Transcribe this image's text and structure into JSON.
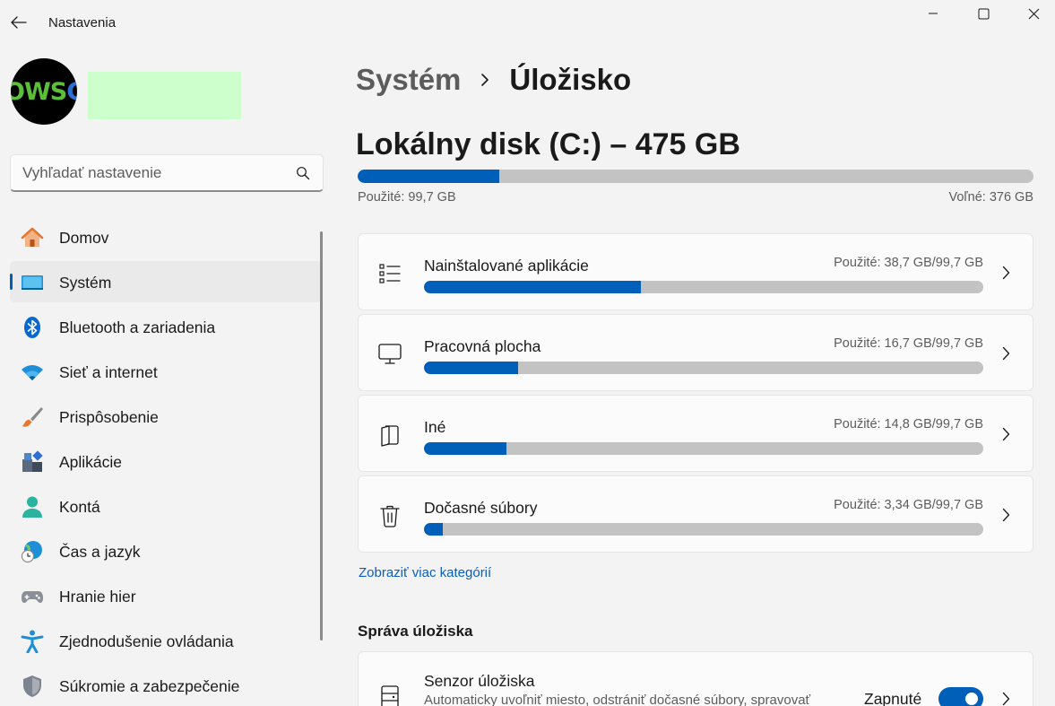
{
  "window": {
    "title": "Nastavenia"
  },
  "profile": {
    "avatar_text": "OWSC"
  },
  "search": {
    "placeholder": "Vyhľadať nastavenie"
  },
  "sidebar": {
    "items": [
      {
        "label": "Domov",
        "icon": "home-icon",
        "active": false
      },
      {
        "label": "Systém",
        "icon": "system-monitor-icon",
        "active": true
      },
      {
        "label": "Bluetooth a zariadenia",
        "icon": "bluetooth-icon",
        "active": false
      },
      {
        "label": "Sieť a internet",
        "icon": "wifi-icon",
        "active": false
      },
      {
        "label": "Prispôsobenie",
        "icon": "paintbrush-icon",
        "active": false
      },
      {
        "label": "Aplikácie",
        "icon": "apps-icon",
        "active": false
      },
      {
        "label": "Kontá",
        "icon": "user-icon",
        "active": false
      },
      {
        "label": "Čas a jazyk",
        "icon": "globe-clock-icon",
        "active": false
      },
      {
        "label": "Hranie hier",
        "icon": "gamepad-icon",
        "active": false
      },
      {
        "label": "Zjednodušenie ovládania",
        "icon": "accessibility-icon",
        "active": false
      },
      {
        "label": "Súkromie a zabezpečenie",
        "icon": "shield-icon",
        "active": false
      }
    ]
  },
  "breadcrumb": {
    "parent": "Systém",
    "current": "Úložisko"
  },
  "disk": {
    "title": "Lokálny disk (C:) – 475 GB",
    "used_label": "Použité: 99,7 GB",
    "free_label": "Voľné: 376 GB",
    "used_fraction": 0.21
  },
  "categories": [
    {
      "label": "Nainštalované aplikácie",
      "usage": "Použité: 38,7 GB/99,7 GB",
      "fraction": 0.388,
      "icon": "list-icon"
    },
    {
      "label": "Pracovná plocha",
      "usage": "Použité: 16,7 GB/99,7 GB",
      "fraction": 0.168,
      "icon": "desktop-monitor-icon"
    },
    {
      "label": "Iné",
      "usage": "Použité: 14,8 GB/99,7 GB",
      "fraction": 0.148,
      "icon": "documents-icon"
    },
    {
      "label": "Dočasné súbory",
      "usage": "Použité: 3,34 GB/99,7 GB",
      "fraction": 0.034,
      "icon": "trash-icon"
    }
  ],
  "more_categories_link": "Zobraziť viac kategórií",
  "management": {
    "section_title": "Správa úložiska",
    "sense": {
      "title": "Senzor úložiska",
      "description": "Automaticky uvoľniť miesto, odstrániť dočasné súbory, spravovať",
      "state": "Zapnuté",
      "enabled": true
    }
  },
  "colors": {
    "accent": "#005fb8",
    "track": "#c3c3c3",
    "background": "#f3f3f3",
    "card": "#fbfbfb"
  }
}
